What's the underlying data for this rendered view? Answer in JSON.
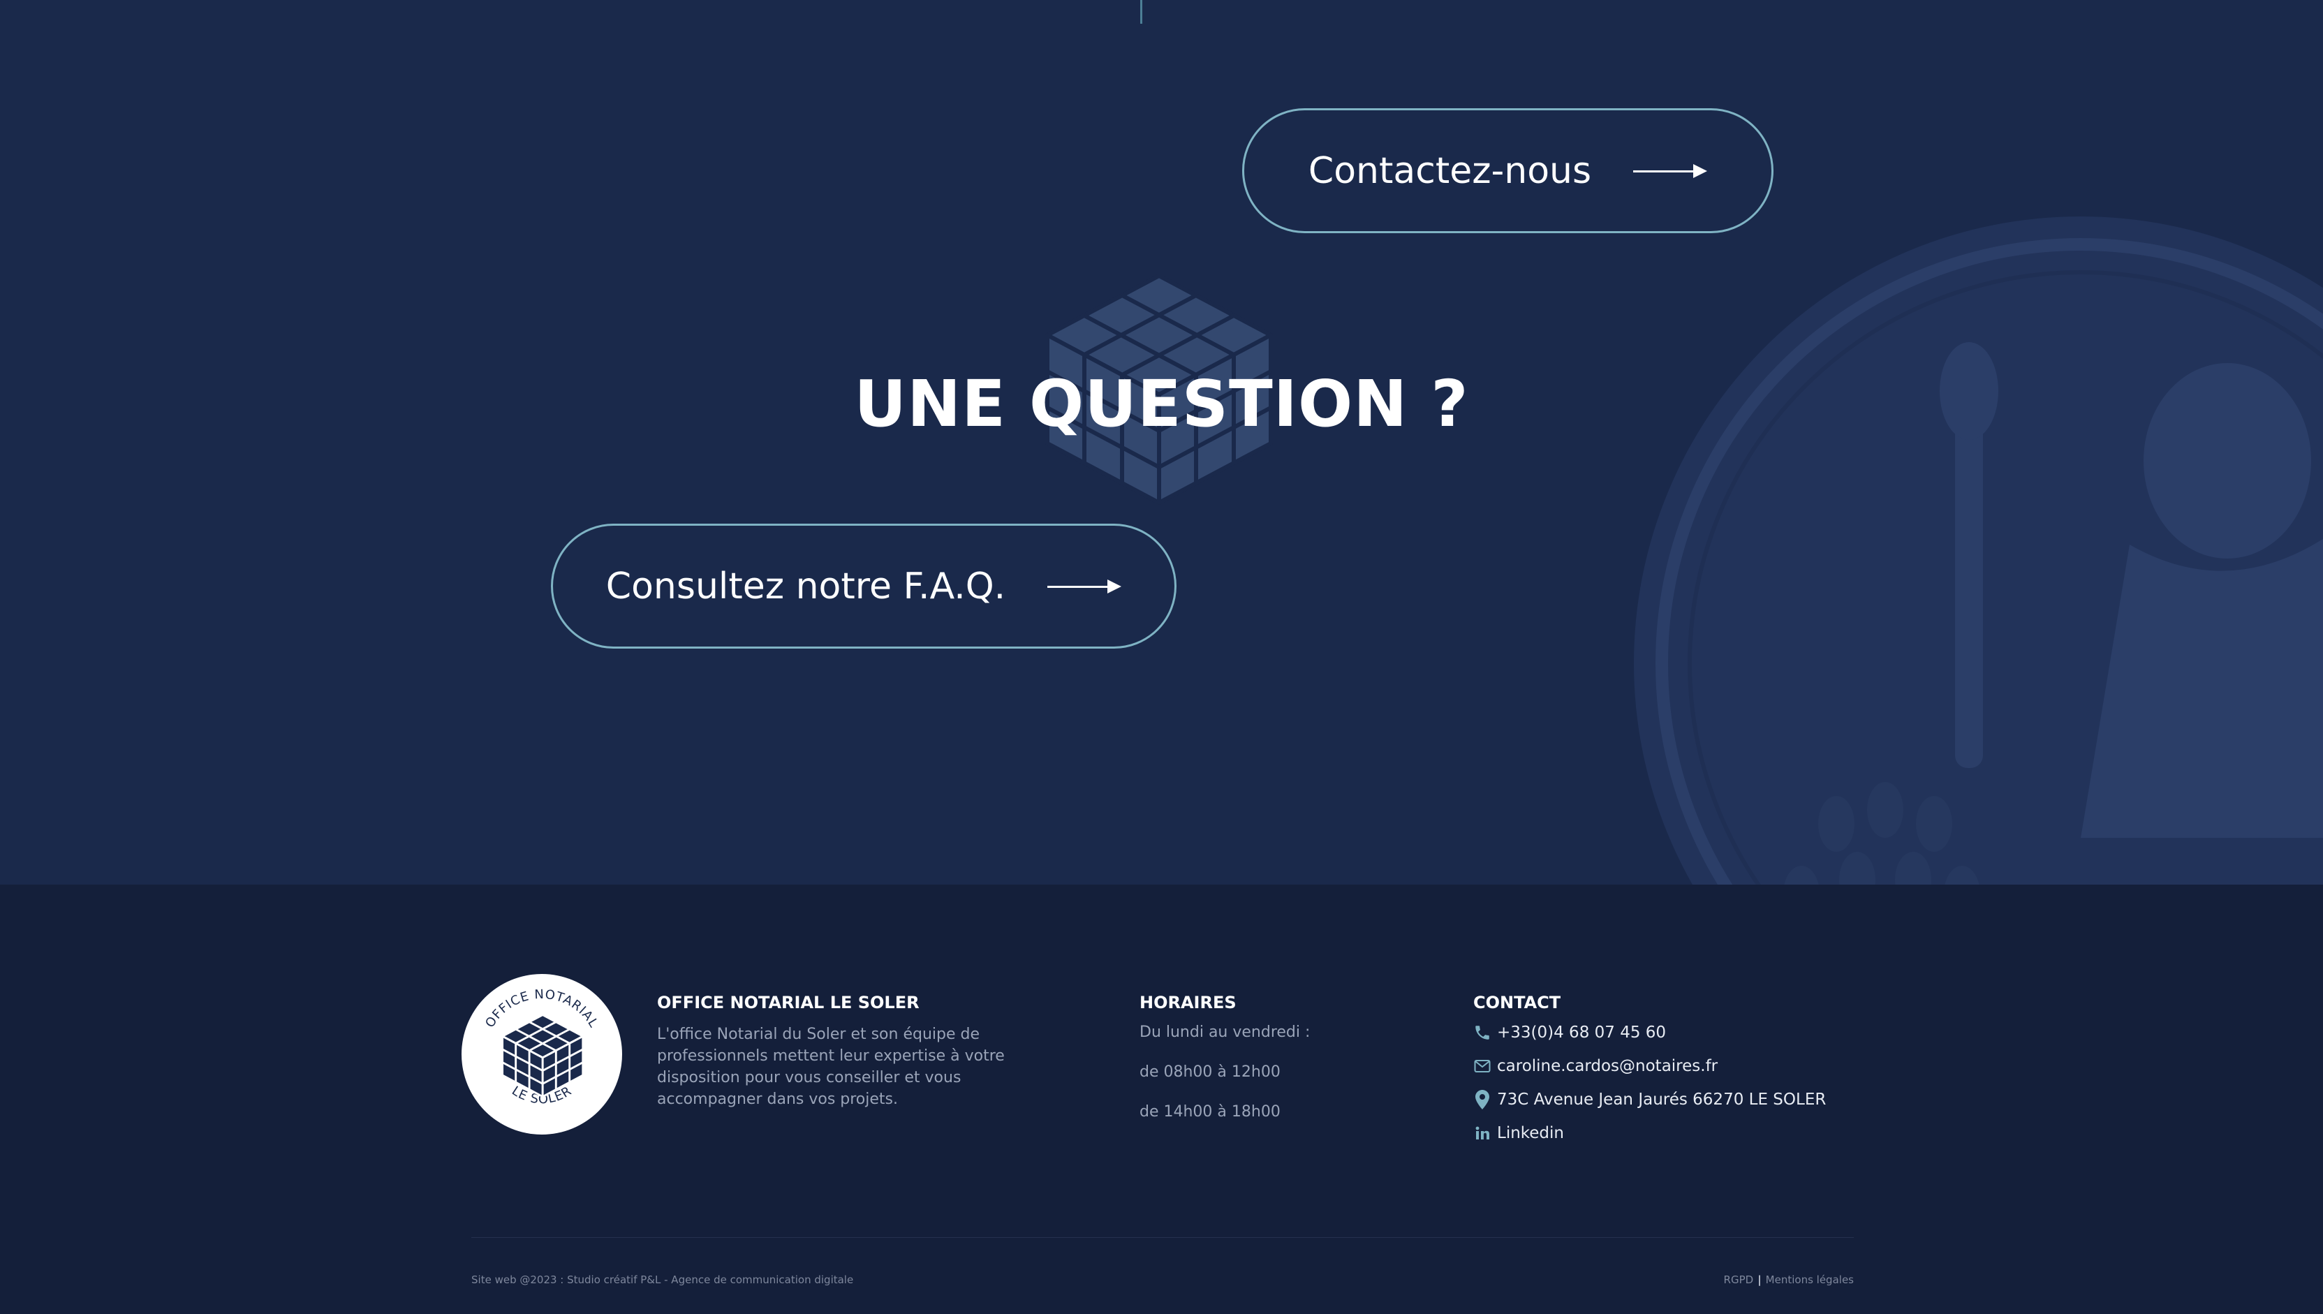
{
  "cta": {
    "title": "UNE QUESTION ?",
    "faq_button": "Consultez notre F.A.Q.",
    "contact_button": "Contactez-nous"
  },
  "footer": {
    "logo": {
      "top_text": "OFFICE NOTARIAL",
      "bottom_text": "LE SOLER"
    },
    "about": {
      "heading": "OFFICE NOTARIAL LE SOLER",
      "text": "L'office Notarial du Soler et son équipe de professionnels mettent leur expertise à votre disposition pour vous conseiller et vous accompagner dans vos projets."
    },
    "hours": {
      "heading": "HORAIRES",
      "days": "Du lundi au vendredi :",
      "morning": "de 08h00 à 12h00",
      "afternoon": "de 14h00 à 18h00"
    },
    "contact": {
      "heading": "CONTACT",
      "phone": "+33(0)4 68 07 45 60",
      "email": "caroline.cardos@notaires.fr",
      "address": "73C Avenue Jean Jaurés 66270 LE SOLER",
      "linkedin": "Linkedin"
    },
    "credit": "Site web @2023 : Studio créatif P&L - Agence de communication digitale",
    "legal": {
      "rgpd": "RGPD",
      "separator": "|",
      "mentions": "Mentions légales"
    }
  },
  "icons": {
    "phone": "phone-icon",
    "email": "envelope-icon",
    "address": "map-pin-icon",
    "linkedin": "linkedin-icon",
    "arrow": "arrow-right-icon"
  },
  "colors": {
    "section_bg": "#1a294b",
    "footer_bg": "#141f3a",
    "accent": "#7fb3c4",
    "text": "#ffffff",
    "muted": "#9aa4b8"
  }
}
